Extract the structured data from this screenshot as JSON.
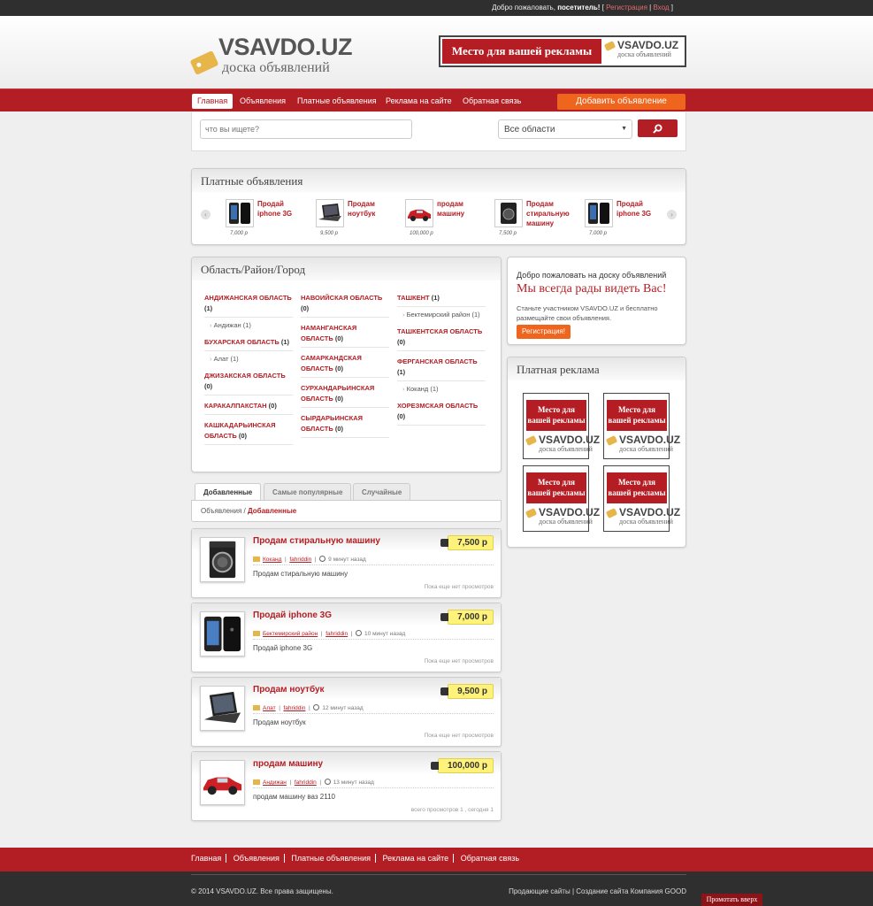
{
  "topbar": {
    "welcome": "Добро пожаловать,",
    "visitor": "посетитель!",
    "register": "Регистрация",
    "login": "Вход"
  },
  "logo": {
    "name": "VSAVDO.UZ",
    "subtitle": "доска объявлений"
  },
  "banner": {
    "ad_text": "Место для вашей рекламы",
    "logo": "VSAVDO.UZ",
    "logo_sub": "доска объявлений"
  },
  "nav": {
    "items": [
      "Главная",
      "Объявления",
      "Платные объявления",
      "Реклама на сайте",
      "Обратная связь"
    ],
    "add_button": "Добавить объявление"
  },
  "search": {
    "placeholder": "что вы ищете?",
    "region": "Все области",
    "search_icon": "search-icon"
  },
  "paid": {
    "title": "Платные объявления",
    "items": [
      {
        "title": "Продай iphone 3G",
        "price": "7,000 р",
        "icon": "phone-icon"
      },
      {
        "title": "Продам ноутбук",
        "price": "9,500 р",
        "icon": "laptop-icon"
      },
      {
        "title": "продам машину",
        "price": "100,000 р",
        "icon": "car-icon"
      },
      {
        "title": "Продам стиральную машину",
        "price": "7,500 р",
        "icon": "washer-icon"
      },
      {
        "title": "Продай iphone 3G",
        "price": "7,000 р",
        "icon": "phone-icon"
      }
    ]
  },
  "regions": {
    "title": "Область/Район/Город",
    "col1": [
      {
        "name": "АНДИЖАНСКАЯ ОБЛАСТЬ",
        "count": "(1)",
        "sub": "Андижан (1)"
      },
      {
        "name": "БУХАРСКАЯ ОБЛАСТЬ",
        "count": "(1)",
        "sub": "Алат (1)"
      },
      {
        "name": "ДЖИЗАКСКАЯ ОБЛАСТЬ",
        "count": "(0)"
      },
      {
        "name": "КАРАКАЛПАКСТАН",
        "count": "(0)"
      },
      {
        "name": "КАШКАДАРЬИНСКАЯ ОБЛАСТЬ",
        "count": "(0)"
      }
    ],
    "col2": [
      {
        "name": "НАВОИЙСКАЯ ОБЛАСТЬ",
        "count": "(0)"
      },
      {
        "name": "НАМАНГАНСКАЯ ОБЛАСТЬ",
        "count": "(0)"
      },
      {
        "name": "САМАРКАНДСКАЯ ОБЛАСТЬ",
        "count": "(0)"
      },
      {
        "name": "СУРХАНДАРЬИНСКАЯ ОБЛАСТЬ",
        "count": "(0)"
      },
      {
        "name": "СЫРДАРЬИНСКАЯ ОБЛАСТЬ",
        "count": "(0)"
      }
    ],
    "col3": [
      {
        "name": "ТАШКЕНТ",
        "count": "(1)",
        "sub": "Бектемирский район (1)"
      },
      {
        "name": "ТАШКЕНТСКАЯ ОБЛАСТЬ",
        "count": "(0)"
      },
      {
        "name": "ФЕРГАНСКАЯ ОБЛАСТЬ",
        "count": "(1)",
        "sub": "Коканд (1)"
      },
      {
        "name": "ХОРЕЗМСКАЯ ОБЛАСТЬ",
        "count": "(0)"
      }
    ]
  },
  "welcome_box": {
    "line1": "Добро пожаловать на доску объявлений",
    "line2": "Мы всегда рады видеть Вас!",
    "line3": "Станьте участником VSAVDO.UZ и бесплатно размещайте свои объявления.",
    "button": "Регистрация!"
  },
  "ads": {
    "title": "Платная реклама",
    "tile_text": "Место для вашей рекламы",
    "logo": "VSAVDO.UZ",
    "logo_sub": "доска объявлений"
  },
  "tabs": [
    "Добавленные",
    "Самые популярные",
    "Случайные"
  ],
  "breadcrumb": {
    "parent": "Объявления",
    "sep": "/",
    "current": "Добавленные"
  },
  "listings": [
    {
      "title": "Продам стиральную машину",
      "price": "7,500 р",
      "location": "Коканд",
      "user": "fahriddin",
      "time": "9 минут назад",
      "desc": "Продам стиральную машину",
      "views": "Пока еще нет просмотров",
      "icon": "washer-icon"
    },
    {
      "title": "Продай iphone 3G",
      "price": "7,000 р",
      "location": "Бектемирский район",
      "user": "fahriddin",
      "time": "10 минут назад",
      "desc": "Продай iphone 3G",
      "views": "Пока еще нет просмотров",
      "icon": "phone-icon"
    },
    {
      "title": "Продам ноутбук",
      "price": "9,500 р",
      "location": "Алат",
      "user": "fahriddin",
      "time": "12 минут назад",
      "desc": "Продам ноутбук",
      "views": "Пока еще нет просмотров",
      "icon": "laptop-icon"
    },
    {
      "title": "продам машину",
      "price": "100,000 р",
      "location": "Андижан",
      "user": "fahriddin",
      "time": "13 минут назад",
      "desc": "продам машину ваз 2110",
      "views": "всего просмотров 1 , сегодня 1",
      "icon": "car-icon"
    }
  ],
  "footer": {
    "nav": [
      "Главная",
      "Объявления",
      "Платные объявления",
      "Реклама на сайте",
      "Обратная связь"
    ],
    "copyright": "© 2014 VSAVDO.UZ. Все права защищены.",
    "credit": "Продающие сайты | Создание сайта Компания GOOD",
    "to_top": "Промотать вверх"
  },
  "colors": {
    "brand_red": "#b31e24",
    "accent_orange": "#f0651e",
    "price_yellow": "#fff27a"
  }
}
